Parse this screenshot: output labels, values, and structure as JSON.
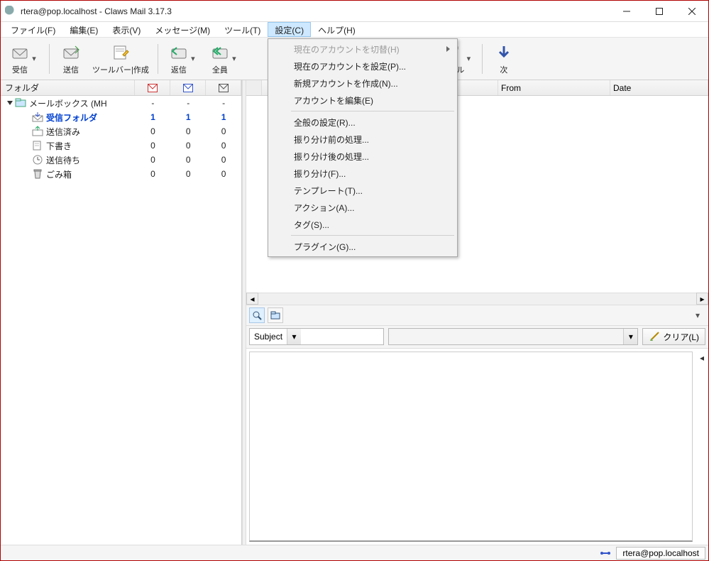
{
  "titlebar": {
    "title": "rtera@pop.localhost - Claws Mail 3.17.3"
  },
  "menubar": {
    "file": "ファイル(F)",
    "edit": "編集(E)",
    "view": "表示(V)",
    "message": "メッセージ(M)",
    "tool": "ツール(T)",
    "config": "設定(C)",
    "help": "ヘルプ(H)"
  },
  "toolbar": {
    "receive": "受信",
    "send": "送信",
    "compose": "ツールバー|作成",
    "reply": "返信",
    "replyall": "全員",
    "mail": "メール",
    "next": "次"
  },
  "settings_menu": {
    "switch_account": "現在のアカウントを切替(H)",
    "set_account": "現在のアカウントを設定(P)...",
    "new_account": "新規アカウントを作成(N)...",
    "edit_accounts": "アカウントを編集(E)",
    "prefs": "全般の設定(R)...",
    "pre_filter": "振り分け前の処理...",
    "post_filter": "振り分け後の処理...",
    "filter": "振り分け(F)...",
    "template": "テンプレート(T)...",
    "action": "アクション(A)...",
    "tag": "タグ(S)...",
    "plugin": "プラグイン(G)..."
  },
  "folder_header": {
    "label": "フォルダ"
  },
  "folders": {
    "mailbox": {
      "name": "メールボックス (MH",
      "c1": "-",
      "c2": "-",
      "c3": "-"
    },
    "inbox": {
      "name": "受信フォルダ",
      "c1": "1",
      "c2": "1",
      "c3": "1"
    },
    "sent": {
      "name": "送信済み",
      "c1": "0",
      "c2": "0",
      "c3": "0"
    },
    "draft": {
      "name": "下書き",
      "c1": "0",
      "c2": "0",
      "c3": "0"
    },
    "queue": {
      "name": "送信待ち",
      "c1": "0",
      "c2": "0",
      "c3": "0"
    },
    "trash": {
      "name": "ごみ箱",
      "c1": "0",
      "c2": "0",
      "c3": "0"
    }
  },
  "list_header": {
    "from": "From",
    "date": "Date"
  },
  "search": {
    "subject_label": "Subject",
    "clear": "クリア(L)"
  },
  "status": {
    "account": "rtera@pop.localhost"
  }
}
